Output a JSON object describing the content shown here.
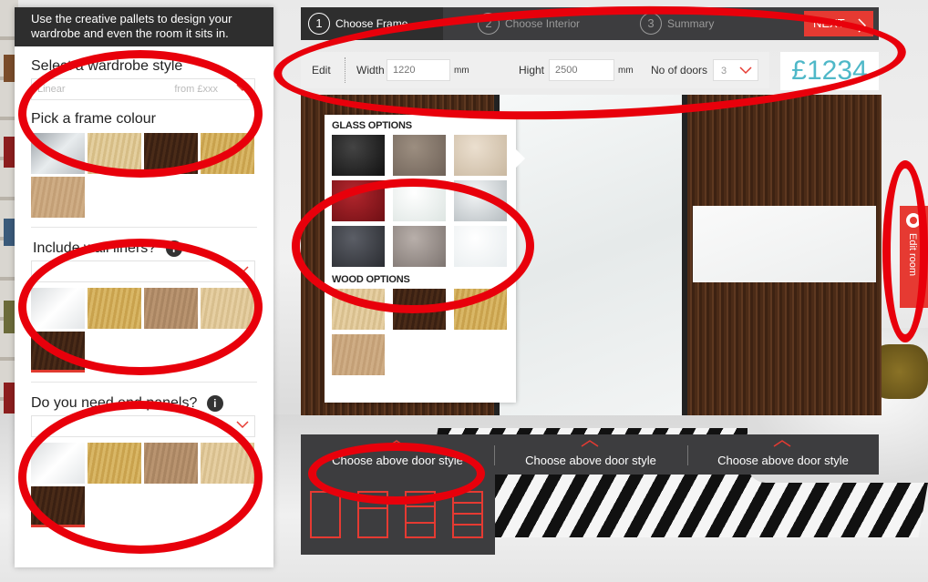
{
  "intro": {
    "line1": "Use the creative pallets to design your",
    "line2": "wardrobe and even the room it sits in."
  },
  "wardrobe_style": {
    "title": "Select a wardrobe style",
    "selected": "Linear",
    "price": "from £xxx"
  },
  "frame_colour": {
    "title": "Pick a frame colour",
    "swatches": [
      "mirror-silver",
      "light-oak",
      "dark-walnut",
      "gold-oak",
      "pale-oak"
    ]
  },
  "wall_liners": {
    "title": "Include wall liners?",
    "info_icon": "i",
    "selected": "4",
    "swatches": [
      "white-mirror",
      "gold-oak",
      "medium-oak",
      "light-oak",
      "dark-walnut"
    ]
  },
  "end_panels": {
    "title": "Do you need end panels?",
    "info_icon": "i",
    "selected": "",
    "swatches": [
      "white-mirror",
      "gold-oak",
      "medium-oak",
      "light-oak",
      "dark-walnut"
    ]
  },
  "steps": {
    "step1_num": "1",
    "step1_label": "Choose Frame",
    "step2_num": "2",
    "step2_label": "Choose Interior",
    "step3_num": "3",
    "step3_label": "Summary",
    "next_label": "NEXT"
  },
  "edit_bar": {
    "edit_label": "Edit",
    "width_label": "Width",
    "width_value": "1220",
    "width_unit": "mm",
    "height_label": "Hight",
    "height_value": "2500",
    "height_unit": "mm",
    "doors_label": "No of doors",
    "doors_value": "3"
  },
  "price": "£1234",
  "options": {
    "glass_title": "GLASS OPTIONS",
    "glass_swatches": [
      "black",
      "taupe",
      "beige",
      "red",
      "white",
      "silver",
      "charcoal",
      "grey",
      "frost"
    ],
    "wood_title": "WOOD OPTIONS",
    "wood_swatches": [
      "light-oak",
      "dark-walnut",
      "gold-oak",
      "pale-oak"
    ]
  },
  "edit_room": "Edit room",
  "door_style": {
    "item1": "Choose above door style",
    "item2": "Choose above door style",
    "item3": "Choose above door style"
  },
  "colors": {
    "accent": "#e63a32",
    "price": "#4fb8c8",
    "annotation": "#e8000b",
    "dark_bar": "#3d3d3f"
  }
}
